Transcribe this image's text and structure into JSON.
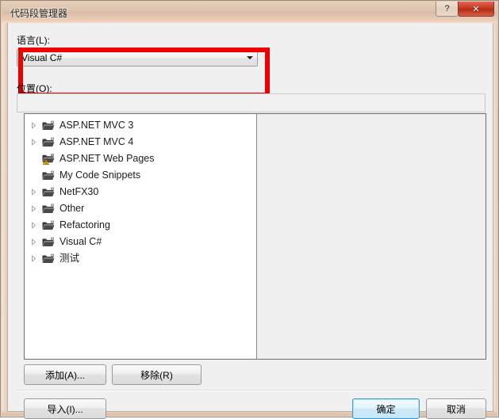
{
  "window": {
    "title": "代码段管理器",
    "help_button": "?",
    "close_button": "✕",
    "help_icon_name": "help-icon",
    "close_icon_name": "close-icon"
  },
  "form": {
    "language_label": "语言(L):",
    "language_value": "Visual C#",
    "language_options": [
      "Visual C#"
    ],
    "location_label": "位置(O):",
    "location_value": "",
    "location_placeholder": ""
  },
  "annotation": {
    "color": "#ee0000",
    "shape": "rectangle",
    "target": "language-group"
  },
  "tree": {
    "items": [
      {
        "label": "ASP.NET MVC 3",
        "expandable": true,
        "icon": "folder-icon",
        "warning": false
      },
      {
        "label": "ASP.NET MVC 4",
        "expandable": true,
        "icon": "folder-icon",
        "warning": false
      },
      {
        "label": "ASP.NET Web Pages",
        "expandable": false,
        "icon": "folder-warning-icon",
        "warning": true
      },
      {
        "label": "My Code Snippets",
        "expandable": false,
        "icon": "folder-icon",
        "warning": false
      },
      {
        "label": "NetFX30",
        "expandable": true,
        "icon": "folder-icon",
        "warning": false
      },
      {
        "label": "Other",
        "expandable": true,
        "icon": "folder-icon",
        "warning": false
      },
      {
        "label": "Refactoring",
        "expandable": true,
        "icon": "folder-icon",
        "warning": false
      },
      {
        "label": "Visual C#",
        "expandable": true,
        "icon": "folder-icon",
        "warning": false
      },
      {
        "label": "测试",
        "expandable": true,
        "icon": "folder-icon",
        "warning": false
      }
    ]
  },
  "buttons": {
    "add": "添加(A)...",
    "remove": "移除(R)",
    "import": "导入(I)...",
    "ok": "确定",
    "cancel": "取消"
  },
  "colors": {
    "accent_default_button": "#3c9cc8",
    "annotation": "#ee0000",
    "title_bar": "#dcc3ad",
    "close_button": "#c5381f"
  }
}
